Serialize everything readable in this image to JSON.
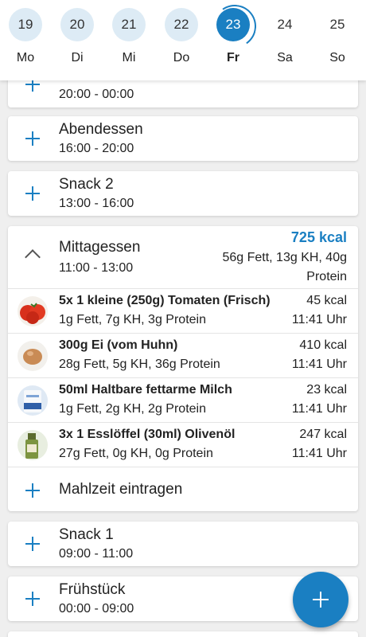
{
  "week": [
    {
      "num": "19",
      "label": "Mo"
    },
    {
      "num": "20",
      "label": "Di"
    },
    {
      "num": "21",
      "label": "Mi"
    },
    {
      "num": "22",
      "label": "Do"
    },
    {
      "num": "23",
      "label": "Fr"
    },
    {
      "num": "24",
      "label": "Sa"
    },
    {
      "num": "25",
      "label": "So"
    }
  ],
  "meals": {
    "partial": {
      "time": "20:00 - 00:00"
    },
    "abendessen": {
      "title": "Abendessen",
      "time": "16:00 - 20:00"
    },
    "snack2": {
      "title": "Snack 2",
      "time": "13:00 - 16:00"
    },
    "mittagessen": {
      "title": "Mittagessen",
      "time": "11:00 - 13:00",
      "kcal": "725 kcal",
      "macros": "56g Fett, 13g KH, 40g Protein",
      "items": [
        {
          "name": "5x 1 kleine (250g) Tomaten (Frisch)",
          "macros": "1g Fett, 7g KH, 3g Protein",
          "kcal": "45 kcal",
          "time": "11:41 Uhr",
          "icon": "tomato-icon"
        },
        {
          "name": "300g Ei (vom Huhn)",
          "macros": "28g Fett, 5g KH, 36g Protein",
          "kcal": "410 kcal",
          "time": "11:41 Uhr",
          "icon": "egg-icon"
        },
        {
          "name": "50ml Haltbare fettarme Milch",
          "macros": "1g Fett, 2g KH, 2g Protein",
          "kcal": "23 kcal",
          "time": "11:41 Uhr",
          "icon": "milk-icon"
        },
        {
          "name": "3x 1 Esslöffel (30ml) Olivenöl",
          "macros": "27g Fett, 0g KH, 0g Protein",
          "kcal": "247 kcal",
          "time": "11:41 Uhr",
          "icon": "olive-oil-icon"
        }
      ],
      "add_label": "Mahlzeit eintragen"
    },
    "snack1": {
      "title": "Snack 1",
      "time": "09:00 - 11:00"
    },
    "fruehstueck": {
      "title": "Frühstück",
      "time": "00:00 - 09:00"
    }
  },
  "colors": {
    "accent": "#1a7fc2",
    "day_bg": "#ddebf5"
  }
}
